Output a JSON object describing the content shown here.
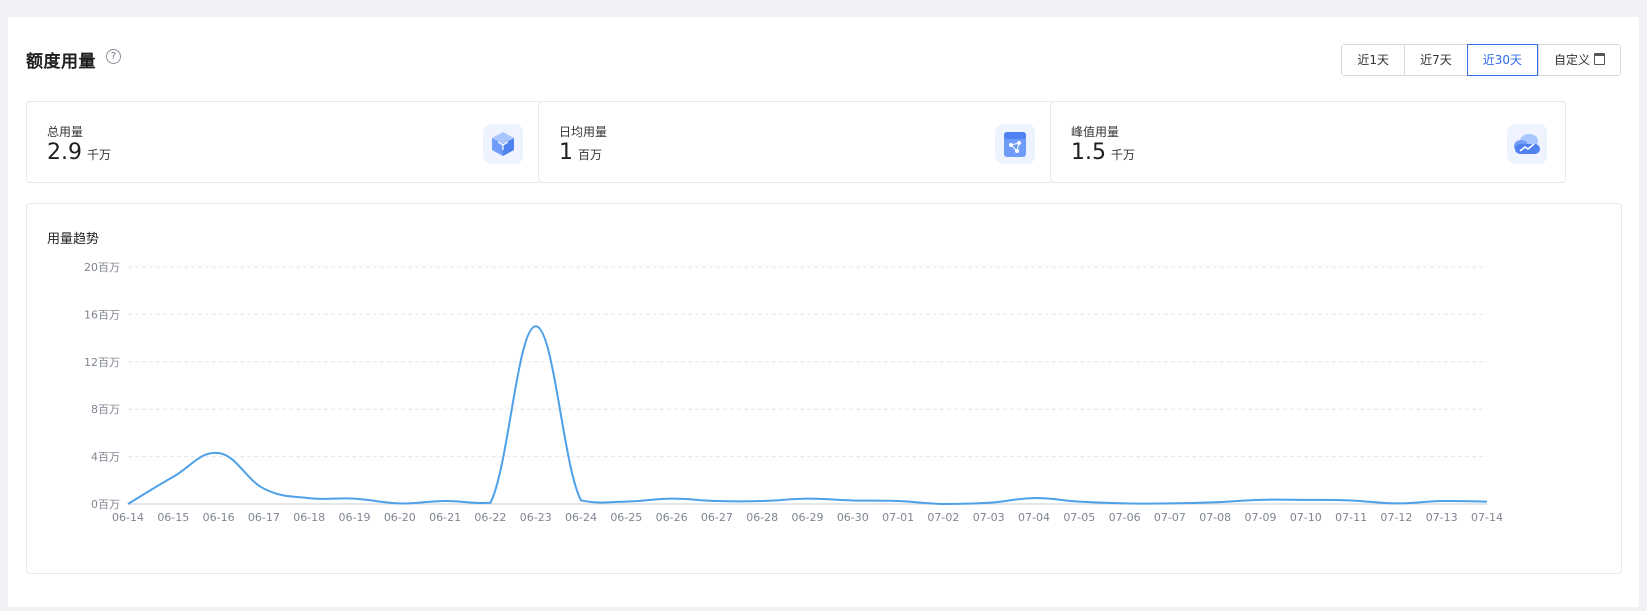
{
  "header": {
    "title": "额度用量",
    "help_icon": "question-circle-icon",
    "help_glyph": "?",
    "range_options": [
      "近1天",
      "近7天",
      "近30天",
      "自定义"
    ],
    "active_range": "近30天",
    "calendar_icon": "calendar-icon"
  },
  "cards": [
    {
      "label": "总用量",
      "value": "2.9",
      "unit": "千万",
      "icon": "cube-icon"
    },
    {
      "label": "日均用量",
      "value": "1",
      "unit": "百万",
      "icon": "share-card-icon"
    },
    {
      "label": "峰值用量",
      "value": "1.5",
      "unit": "千万",
      "icon": "cloud-trend-icon"
    }
  ],
  "colors": {
    "accent": "#2f6ee8",
    "line": "#4ea0e8",
    "grid": "#e3e5e9",
    "icon_bg": "#eef3ff",
    "icon_blue": "#5b8ff9"
  },
  "chart_data": {
    "type": "line",
    "title": "用量趋势",
    "xlabel": "",
    "ylabel": "",
    "unit_suffix": "百万",
    "ylim": [
      0,
      20
    ],
    "yticks": [
      0,
      4,
      8,
      12,
      16,
      20
    ],
    "ytick_labels": [
      "0百万",
      "4百万",
      "8百万",
      "12百万",
      "16百万",
      "20百万"
    ],
    "grid": true,
    "legend": "none",
    "categories": [
      "06-14",
      "06-15",
      "06-16",
      "06-17",
      "06-18",
      "06-19",
      "06-20",
      "06-21",
      "06-22",
      "06-23",
      "06-24",
      "06-25",
      "06-26",
      "06-27",
      "06-28",
      "06-29",
      "06-30",
      "07-01",
      "07-02",
      "07-03",
      "07-04",
      "07-05",
      "07-06",
      "07-07",
      "07-08",
      "07-09",
      "07-10",
      "07-11",
      "07-12",
      "07-13",
      "07-14"
    ],
    "series": [
      {
        "values": [
          0.0,
          2.3,
          4.3,
          1.3,
          0.5,
          0.45,
          0.05,
          0.25,
          0.1,
          15.0,
          0.3,
          0.2,
          0.45,
          0.25,
          0.25,
          0.45,
          0.3,
          0.25,
          0.0,
          0.1,
          0.5,
          0.2,
          0.05,
          0.05,
          0.15,
          0.35,
          0.35,
          0.3,
          0.05,
          0.25,
          0.2
        ]
      }
    ]
  }
}
